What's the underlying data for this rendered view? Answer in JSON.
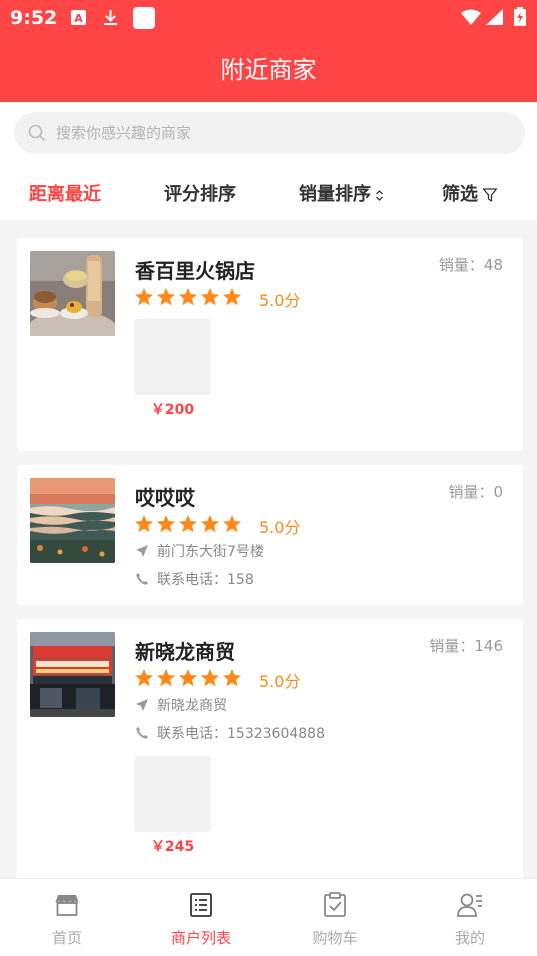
{
  "status_bar": {
    "time": "9:52"
  },
  "header": {
    "title": "附近商家"
  },
  "search": {
    "placeholder": "搜索你感兴趣的商家"
  },
  "sort_bar": {
    "items": [
      {
        "label": "距离最近",
        "active": true
      },
      {
        "label": "评分排序",
        "active": false
      },
      {
        "label": "销量排序",
        "active": false
      },
      {
        "label": "筛选",
        "active": false
      }
    ]
  },
  "shops": [
    {
      "name": "香百里火锅店",
      "sales": "销量：48",
      "rating": 5,
      "score": "5.0分",
      "goods_price": "￥200"
    },
    {
      "name": "哎哎哎",
      "sales": "销量：0",
      "rating": 5,
      "score": "5.0分",
      "address": "前门东大街7号楼",
      "phone": "联系电话：158"
    },
    {
      "name": "新晓龙商贸",
      "sales": "销量：146",
      "rating": 5,
      "score": "5.0分",
      "address": "新晓龙商贸",
      "phone": "联系电话：15323604888",
      "goods_price": "￥245"
    }
  ],
  "tab_bar": {
    "items": [
      {
        "label": "首页",
        "icon": "store-icon",
        "active": false
      },
      {
        "label": "商户列表",
        "icon": "list-icon",
        "active": true
      },
      {
        "label": "购物车",
        "icon": "clipboard-icon",
        "active": false
      },
      {
        "label": "我的",
        "icon": "user-icon",
        "active": false
      }
    ]
  },
  "colors": {
    "primary": "#ff4545",
    "star": "#ff8a1a",
    "muted": "#999999"
  }
}
